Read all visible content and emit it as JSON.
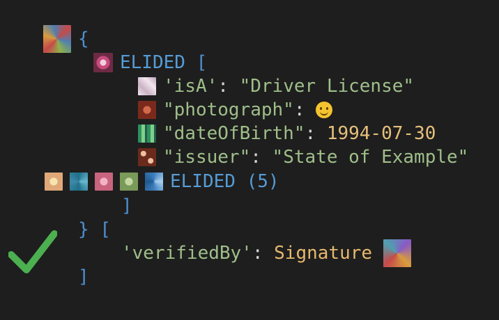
{
  "envelope": {
    "open_brace": "{",
    "close_brace": "}",
    "assertions_open": "[",
    "assertions_close": "]"
  },
  "elided_block": {
    "keyword": "ELIDED",
    "open_bracket": "[",
    "close_bracket": "]",
    "assertions": [
      {
        "key": "'isA'",
        "value": "\"Driver License\""
      },
      {
        "key": "\"photograph\"",
        "value_icon": "slightly-smiling-face-emoji"
      },
      {
        "key": "\"dateOfBirth\"",
        "value": "1994-07-30"
      },
      {
        "key": "\"issuer\"",
        "value": "\"State of Example\""
      }
    ],
    "elided_count_label": "ELIDED (5)"
  },
  "verification": {
    "key": "'verifiedBy'",
    "value": "Signature"
  },
  "colors": {
    "background": "#1e1e1e",
    "keyword": "#569cd6",
    "string": "#9fbf8a",
    "number": "#e7c07b",
    "check": "#4caf50"
  }
}
